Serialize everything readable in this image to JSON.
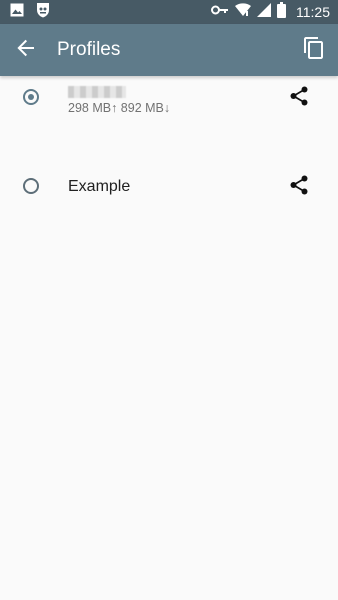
{
  "status_bar": {
    "time": "11:25",
    "icons": [
      "image-icon",
      "shield-app-icon",
      "key-icon",
      "wifi-icon",
      "signal-icon",
      "battery-icon"
    ]
  },
  "app_bar": {
    "title": "Profiles",
    "back_icon": "arrow-back-icon",
    "action_icon": "copy-icon",
    "background": "#5f7b8a"
  },
  "profiles": [
    {
      "name": "",
      "name_redacted": true,
      "usage": "298 MB↑ 892 MB↓",
      "selected": true,
      "share_icon": "share-icon"
    },
    {
      "name": "Example",
      "usage": "",
      "selected": false,
      "share_icon": "share-icon"
    }
  ],
  "colors": {
    "status_bar": "#475a65",
    "accent": "#5f7b8a",
    "background": "#fafafa",
    "primary_text": "#212121",
    "secondary_text": "#727272"
  }
}
